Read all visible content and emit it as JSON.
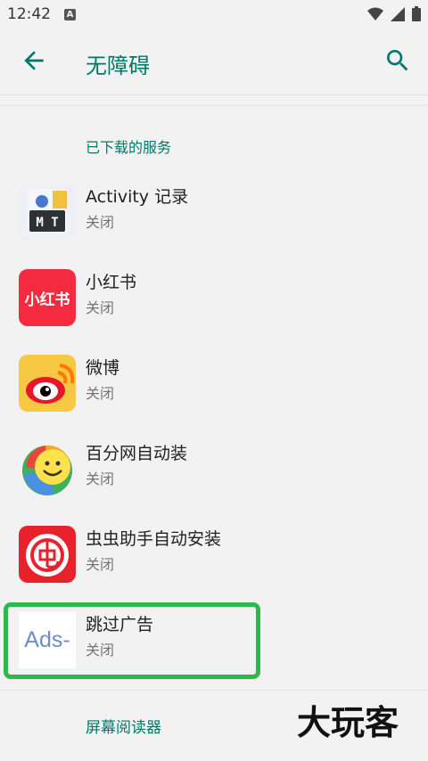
{
  "status_bar": {
    "time": "12:42",
    "notification_letter": "A",
    "icons": [
      "wifi-icon",
      "signal-icon",
      "battery-icon"
    ]
  },
  "app_bar": {
    "title": "无障碍",
    "back_icon": "arrow-left-icon",
    "search_icon": "search-icon"
  },
  "section": {
    "header": "已下载的服务"
  },
  "services": [
    {
      "name": "Activity 记录",
      "status": "关闭",
      "icon": "mt-icon"
    },
    {
      "name": "小红书",
      "status": "关闭",
      "icon": "xiaohongshu-icon",
      "icon_text": "小红书"
    },
    {
      "name": "微博",
      "status": "关闭",
      "icon": "weibo-icon"
    },
    {
      "name": "百分网自动装",
      "status": "关闭",
      "icon": "smiley-icon"
    },
    {
      "name": "虫虫助手自动安装",
      "status": "关闭",
      "icon": "chongchong-icon"
    },
    {
      "name": "跳过广告",
      "status": "关闭",
      "icon": "ads-icon",
      "icon_text": "Ads-"
    }
  ],
  "mt_icon_text": "M T",
  "footer": {
    "label": "屏幕阅读器"
  },
  "watermark": {
    "text": "大玩客"
  },
  "colors": {
    "accent": "#00796b",
    "highlight": "#2db84b",
    "background": "#f2f2f2"
  }
}
